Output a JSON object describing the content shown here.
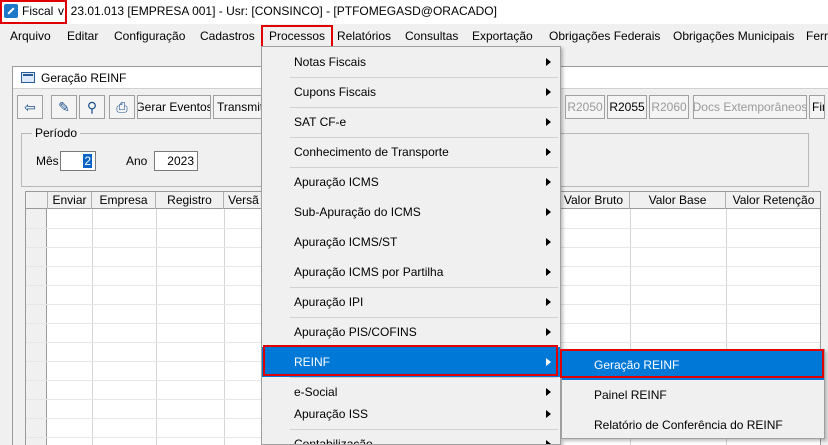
{
  "titlebar": {
    "app_name": "Fiscal",
    "text": "v: 23.01.013   [EMPRESA 001] - Usr: [CONSINCO] - [PTFOMEGASD@ORACADO]"
  },
  "menubar": {
    "items": [
      "Arquivo",
      "Editar",
      "Configuração",
      "Cadastros",
      "Processos",
      "Relatórios",
      "Consultas",
      "Exportação",
      "Obrigações Federais",
      "Obrigações Municipais",
      "Ferra"
    ]
  },
  "window": {
    "title": "Geração REINF",
    "toolbar": {
      "gerar_eventos": "Gerar Eventos",
      "transmitir": "Transmitir",
      "r2050": "R2050",
      "r2055": "R2055",
      "r2060": "R2060",
      "docs_extemporaneos": "Docs Extemporâneos",
      "fin": "Fina"
    },
    "periodo": {
      "legend": "Período",
      "mes_label": "Mês",
      "mes_value": "2",
      "ano_label": "Ano",
      "ano_value": "2023"
    },
    "grid_columns": [
      "Enviar",
      "Empresa",
      "Registro",
      "Versã",
      "Valor Bruto",
      "Valor Base",
      "Valor Retenção"
    ]
  },
  "processos_menu": {
    "items": [
      "Notas Fiscais",
      "Cupons Fiscais",
      "SAT CF-e",
      "Conhecimento de Transporte",
      "Apuração ICMS",
      "Sub-Apuração do ICMS",
      "Apuração ICMS/ST",
      "Apuração ICMS por Partilha",
      "Apuração IPI",
      "Apuração PIS/COFINS",
      "REINF",
      "e-Social",
      "Apuração ISS",
      "Contabilização"
    ]
  },
  "reinf_submenu": {
    "items": [
      "Geração REINF",
      "Painel REINF",
      "Relatório de Conferência do REINF"
    ]
  },
  "colors": {
    "highlight": "#0078d7",
    "annotation_border": "#e00000"
  }
}
